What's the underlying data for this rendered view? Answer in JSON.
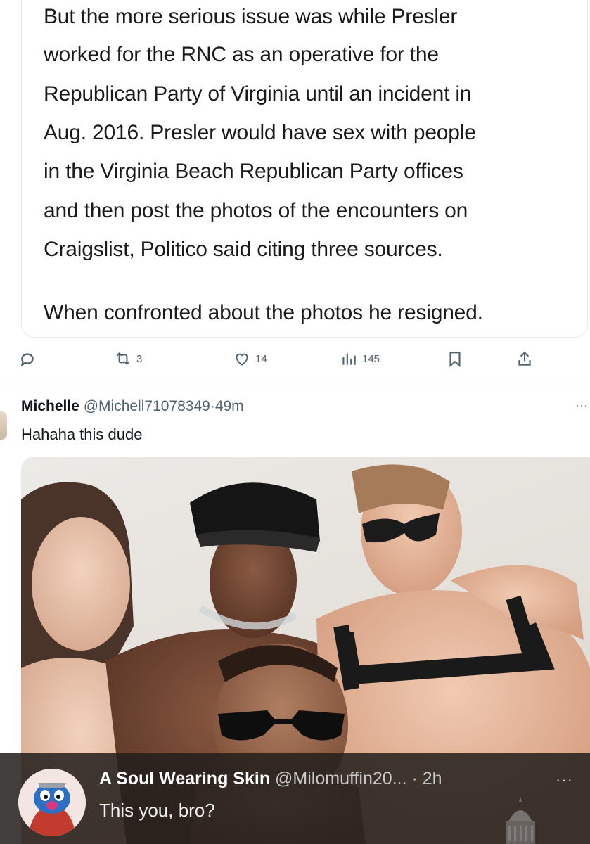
{
  "quoted_post": {
    "paragraph1": [
      "But the more serious issue was while Presler",
      "worked for the RNC as an operative for the",
      "Republican Party of Virginia until an incident in",
      "Aug. 2016. Presler would have sex with people",
      "in the Virginia Beach Republican Party offices",
      "and then post the photos of the encounters on",
      "Craigslist, Politico said citing three sources."
    ],
    "paragraph2": "When confronted about the photos he resigned."
  },
  "actions": {
    "reply_icon": "reply-icon",
    "repost_count": "3",
    "like_count": "14",
    "views_count": "145",
    "bookmark_icon": "bookmark-icon",
    "share_icon": "share-icon"
  },
  "reply": {
    "name": "Michelle",
    "handle": "@Michell71078349",
    "separator": "·",
    "time": "49m",
    "text": "Hahaha this dude",
    "more": "···"
  },
  "overlay": {
    "name": "A Soul Wearing Skin",
    "handle": "@Milomuffin20...",
    "separator": "·",
    "time": "2h",
    "text": "This you, bro?",
    "more": "···"
  },
  "colors": {
    "secondary_text": "#536471",
    "overlay_bg": "#231e1c"
  }
}
